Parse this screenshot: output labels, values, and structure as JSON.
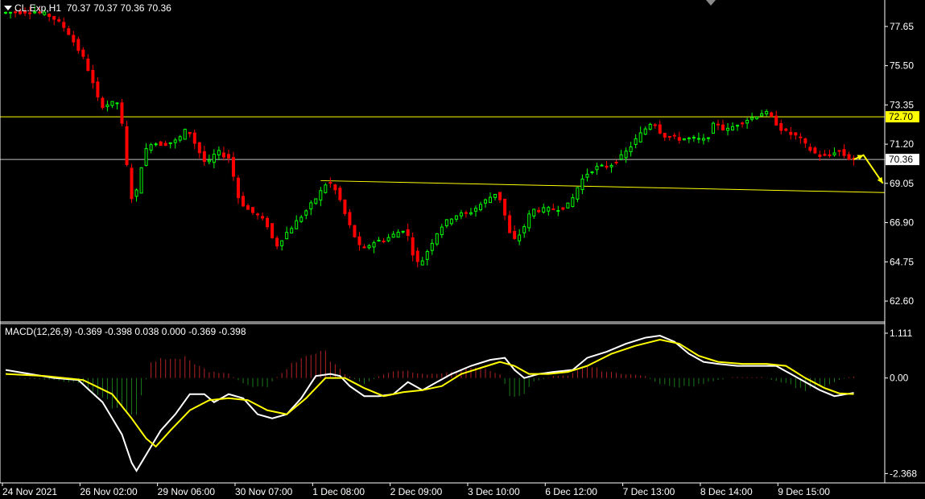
{
  "header": {
    "symbol": "CL.Exp,H1",
    "ohlc": "70.37 70.37 70.36 70.36"
  },
  "macd_header": "MACD(12,26,9) -0.369 -0.398 0.038 0.000 -0.369 -0.398",
  "colors": {
    "background": "#000000",
    "bull_candle": "#00ff00",
    "bear_candle": "#ff0000",
    "level_line": "#ffff00",
    "current_line": "#c0c0c0",
    "macd_main": "#ffffff",
    "macd_signal": "#ffff00",
    "hist_positive": "#b32222",
    "hist_negative": "#1a7a1a",
    "price_tag": "#ffff00",
    "text": "#ffffff"
  },
  "icons": [
    "menu-triangle-icon",
    "scroll-marker-icon",
    "arrow-icon"
  ],
  "chart_data": [
    {
      "type": "candlestick",
      "title": "CL.Exp,H1",
      "price_axis_labels": [
        "77.65",
        "75.50",
        "73.35",
        "71.20",
        "69.05",
        "66.90",
        "64.75",
        "62.60"
      ],
      "time_axis_labels": [
        "24 Nov 2021",
        "26 Nov 02:00",
        "29 Nov 06:00",
        "30 Nov 07:00",
        "1 Dec 08:00",
        "2 Dec 09:00",
        "3 Dec 10:00",
        "6 Dec 12:00",
        "7 Dec 13:00",
        "8 Dec 14:00",
        "9 Dec 15:00"
      ],
      "ylim": [
        61.5,
        79.1
      ],
      "horizontal_level": {
        "value": 72.7,
        "label": "72.70"
      },
      "current_price": {
        "value": 70.36,
        "label": "70.36"
      },
      "trendline": {
        "from": {
          "x": "1 Dec 08:00",
          "y": 69.2
        },
        "to": {
          "x": "9 Dec 15:00",
          "y": 68.5
        }
      },
      "price_path": [
        {
          "x": 0,
          "y": 78.4
        },
        {
          "x": 6,
          "y": 78.5
        },
        {
          "x": 10,
          "y": 78.2
        },
        {
          "x": 13,
          "y": 77.5
        },
        {
          "x": 17,
          "y": 75.7
        },
        {
          "x": 20,
          "y": 73.3
        },
        {
          "x": 24,
          "y": 73.5
        },
        {
          "x": 25,
          "y": 71.0
        },
        {
          "x": 26,
          "y": 69.0
        },
        {
          "x": 27,
          "y": 67.6
        },
        {
          "x": 28,
          "y": 69.6
        },
        {
          "x": 30,
          "y": 71.3
        },
        {
          "x": 33,
          "y": 71.2
        },
        {
          "x": 36,
          "y": 71.4
        },
        {
          "x": 38,
          "y": 72.1
        },
        {
          "x": 40,
          "y": 71.0
        },
        {
          "x": 42,
          "y": 70.0
        },
        {
          "x": 44,
          "y": 70.8
        },
        {
          "x": 47,
          "y": 70.4
        },
        {
          "x": 48,
          "y": 68.5
        },
        {
          "x": 50,
          "y": 67.7
        },
        {
          "x": 53,
          "y": 67.2
        },
        {
          "x": 55,
          "y": 66.6
        },
        {
          "x": 56,
          "y": 65.5
        },
        {
          "x": 58,
          "y": 66.2
        },
        {
          "x": 61,
          "y": 67.1
        },
        {
          "x": 63,
          "y": 67.7
        },
        {
          "x": 65,
          "y": 68.4
        },
        {
          "x": 67,
          "y": 69.2
        },
        {
          "x": 69,
          "y": 68.5
        },
        {
          "x": 71,
          "y": 67.0
        },
        {
          "x": 74,
          "y": 65.3
        },
        {
          "x": 76,
          "y": 65.8
        },
        {
          "x": 79,
          "y": 66.0
        },
        {
          "x": 83,
          "y": 66.6
        },
        {
          "x": 85,
          "y": 64.8
        },
        {
          "x": 86,
          "y": 64.6
        },
        {
          "x": 88,
          "y": 65.6
        },
        {
          "x": 90,
          "y": 66.6
        },
        {
          "x": 93,
          "y": 67.3
        },
        {
          "x": 96,
          "y": 67.4
        },
        {
          "x": 99,
          "y": 68.0
        },
        {
          "x": 102,
          "y": 68.6
        },
        {
          "x": 103,
          "y": 67.8
        },
        {
          "x": 105,
          "y": 65.8
        },
        {
          "x": 107,
          "y": 66.4
        },
        {
          "x": 109,
          "y": 67.6
        },
        {
          "x": 112,
          "y": 67.6
        },
        {
          "x": 115,
          "y": 67.7
        },
        {
          "x": 117,
          "y": 67.9
        },
        {
          "x": 118,
          "y": 68.6
        },
        {
          "x": 120,
          "y": 69.5
        },
        {
          "x": 122,
          "y": 69.9
        },
        {
          "x": 125,
          "y": 70.0
        },
        {
          "x": 128,
          "y": 70.6
        },
        {
          "x": 131,
          "y": 71.6
        },
        {
          "x": 134,
          "y": 72.5
        },
        {
          "x": 136,
          "y": 71.7
        },
        {
          "x": 139,
          "y": 71.5
        },
        {
          "x": 142,
          "y": 71.5
        },
        {
          "x": 145,
          "y": 71.4
        },
        {
          "x": 147,
          "y": 72.5
        },
        {
          "x": 149,
          "y": 71.9
        },
        {
          "x": 152,
          "y": 72.4
        },
        {
          "x": 155,
          "y": 72.7
        },
        {
          "x": 157,
          "y": 73.0
        },
        {
          "x": 159,
          "y": 72.5
        },
        {
          "x": 161,
          "y": 71.9
        },
        {
          "x": 164,
          "y": 71.6
        },
        {
          "x": 166,
          "y": 71.0
        },
        {
          "x": 168,
          "y": 70.6
        },
        {
          "x": 170,
          "y": 70.5
        },
        {
          "x": 172,
          "y": 70.9
        },
        {
          "x": 174,
          "y": 70.5
        },
        {
          "x": 175,
          "y": 70.36
        }
      ],
      "projection_arrow": [
        {
          "x": 175,
          "y": 70.36
        },
        {
          "x": 177,
          "y": 70.6
        },
        {
          "x": 181,
          "y": 69.05
        }
      ]
    },
    {
      "type": "line",
      "title": "MACD(12,26,9)",
      "axis_labels": [
        "1.111",
        "0.00",
        "-2.368"
      ],
      "ylim": [
        -2.6,
        1.35
      ],
      "series": [
        {
          "role": "main",
          "points": [
            {
              "x": 0,
              "y": 0.2
            },
            {
              "x": 5,
              "y": 0.1
            },
            {
              "x": 10,
              "y": 0.0
            },
            {
              "x": 15,
              "y": -0.05
            },
            {
              "x": 20,
              "y": -0.6
            },
            {
              "x": 24,
              "y": -1.4
            },
            {
              "x": 26,
              "y": -2.1
            },
            {
              "x": 27,
              "y": -2.3
            },
            {
              "x": 29,
              "y": -1.9
            },
            {
              "x": 32,
              "y": -1.3
            },
            {
              "x": 35,
              "y": -0.9
            },
            {
              "x": 38,
              "y": -0.4
            },
            {
              "x": 41,
              "y": -0.4
            },
            {
              "x": 43,
              "y": -0.6
            },
            {
              "x": 46,
              "y": -0.4
            },
            {
              "x": 49,
              "y": -0.5
            },
            {
              "x": 52,
              "y": -0.9
            },
            {
              "x": 55,
              "y": -1.0
            },
            {
              "x": 58,
              "y": -0.9
            },
            {
              "x": 61,
              "y": -0.5
            },
            {
              "x": 64,
              "y": 0.05
            },
            {
              "x": 67,
              "y": 0.1
            },
            {
              "x": 69,
              "y": 0.05
            },
            {
              "x": 71,
              "y": -0.2
            },
            {
              "x": 74,
              "y": -0.45
            },
            {
              "x": 77,
              "y": -0.45
            },
            {
              "x": 80,
              "y": -0.4
            },
            {
              "x": 83,
              "y": -0.1
            },
            {
              "x": 86,
              "y": -0.3
            },
            {
              "x": 89,
              "y": -0.1
            },
            {
              "x": 92,
              "y": 0.1
            },
            {
              "x": 96,
              "y": 0.3
            },
            {
              "x": 100,
              "y": 0.45
            },
            {
              "x": 103,
              "y": 0.5
            },
            {
              "x": 105,
              "y": 0.2
            },
            {
              "x": 107,
              "y": 0.0
            },
            {
              "x": 110,
              "y": 0.1
            },
            {
              "x": 113,
              "y": 0.15
            },
            {
              "x": 117,
              "y": 0.2
            },
            {
              "x": 120,
              "y": 0.5
            },
            {
              "x": 124,
              "y": 0.65
            },
            {
              "x": 128,
              "y": 0.85
            },
            {
              "x": 132,
              "y": 1.0
            },
            {
              "x": 135,
              "y": 1.05
            },
            {
              "x": 138,
              "y": 0.9
            },
            {
              "x": 141,
              "y": 0.6
            },
            {
              "x": 144,
              "y": 0.4
            },
            {
              "x": 147,
              "y": 0.35
            },
            {
              "x": 151,
              "y": 0.3
            },
            {
              "x": 155,
              "y": 0.3
            },
            {
              "x": 159,
              "y": 0.3
            },
            {
              "x": 162,
              "y": 0.1
            },
            {
              "x": 165,
              "y": -0.1
            },
            {
              "x": 168,
              "y": -0.3
            },
            {
              "x": 171,
              "y": -0.45
            },
            {
              "x": 175,
              "y": -0.369
            }
          ]
        },
        {
          "role": "signal",
          "points": [
            {
              "x": 0,
              "y": 0.1
            },
            {
              "x": 8,
              "y": 0.05
            },
            {
              "x": 16,
              "y": -0.05
            },
            {
              "x": 22,
              "y": -0.4
            },
            {
              "x": 26,
              "y": -1.0
            },
            {
              "x": 29,
              "y": -1.5
            },
            {
              "x": 31,
              "y": -1.7
            },
            {
              "x": 34,
              "y": -1.3
            },
            {
              "x": 38,
              "y": -0.8
            },
            {
              "x": 42,
              "y": -0.55
            },
            {
              "x": 46,
              "y": -0.5
            },
            {
              "x": 50,
              "y": -0.55
            },
            {
              "x": 54,
              "y": -0.8
            },
            {
              "x": 58,
              "y": -0.9
            },
            {
              "x": 62,
              "y": -0.5
            },
            {
              "x": 66,
              "y": 0.0
            },
            {
              "x": 70,
              "y": 0.0
            },
            {
              "x": 74,
              "y": -0.25
            },
            {
              "x": 78,
              "y": -0.45
            },
            {
              "x": 82,
              "y": -0.35
            },
            {
              "x": 86,
              "y": -0.3
            },
            {
              "x": 90,
              "y": -0.2
            },
            {
              "x": 94,
              "y": 0.1
            },
            {
              "x": 98,
              "y": 0.25
            },
            {
              "x": 102,
              "y": 0.4
            },
            {
              "x": 105,
              "y": 0.3
            },
            {
              "x": 108,
              "y": 0.1
            },
            {
              "x": 112,
              "y": 0.1
            },
            {
              "x": 116,
              "y": 0.15
            },
            {
              "x": 120,
              "y": 0.3
            },
            {
              "x": 125,
              "y": 0.6
            },
            {
              "x": 130,
              "y": 0.8
            },
            {
              "x": 135,
              "y": 0.95
            },
            {
              "x": 139,
              "y": 0.85
            },
            {
              "x": 143,
              "y": 0.55
            },
            {
              "x": 147,
              "y": 0.4
            },
            {
              "x": 152,
              "y": 0.35
            },
            {
              "x": 157,
              "y": 0.35
            },
            {
              "x": 161,
              "y": 0.3
            },
            {
              "x": 165,
              "y": 0.0
            },
            {
              "x": 169,
              "y": -0.25
            },
            {
              "x": 172,
              "y": -0.38
            },
            {
              "x": 175,
              "y": -0.398
            }
          ]
        }
      ],
      "histogram_profile": [
        {
          "x": 0,
          "y": 0.0
        },
        {
          "x": 10,
          "y": -0.05
        },
        {
          "x": 16,
          "y": -0.15
        },
        {
          "x": 22,
          "y": -0.7
        },
        {
          "x": 27,
          "y": -0.9
        },
        {
          "x": 30,
          "y": 0.4
        },
        {
          "x": 34,
          "y": 0.55
        },
        {
          "x": 38,
          "y": 0.45
        },
        {
          "x": 42,
          "y": 0.15
        },
        {
          "x": 46,
          "y": 0.1
        },
        {
          "x": 50,
          "y": -0.2
        },
        {
          "x": 54,
          "y": -0.2
        },
        {
          "x": 58,
          "y": 0.25
        },
        {
          "x": 62,
          "y": 0.6
        },
        {
          "x": 66,
          "y": 0.6
        },
        {
          "x": 70,
          "y": 0.1
        },
        {
          "x": 74,
          "y": -0.15
        },
        {
          "x": 78,
          "y": 0.1
        },
        {
          "x": 82,
          "y": 0.2
        },
        {
          "x": 86,
          "y": 0.1
        },
        {
          "x": 90,
          "y": 0.1
        },
        {
          "x": 94,
          "y": 0.2
        },
        {
          "x": 98,
          "y": 0.25
        },
        {
          "x": 102,
          "y": 0.1
        },
        {
          "x": 104,
          "y": -0.4
        },
        {
          "x": 106,
          "y": -0.5
        },
        {
          "x": 109,
          "y": -0.1
        },
        {
          "x": 113,
          "y": 0.05
        },
        {
          "x": 116,
          "y": 0.05
        },
        {
          "x": 120,
          "y": 0.3
        },
        {
          "x": 124,
          "y": 0.15
        },
        {
          "x": 128,
          "y": 0.1
        },
        {
          "x": 132,
          "y": 0.05
        },
        {
          "x": 134,
          "y": -0.1
        },
        {
          "x": 138,
          "y": -0.25
        },
        {
          "x": 142,
          "y": -0.2
        },
        {
          "x": 145,
          "y": -0.1
        },
        {
          "x": 150,
          "y": 0.02
        },
        {
          "x": 156,
          "y": 0.02
        },
        {
          "x": 160,
          "y": -0.1
        },
        {
          "x": 165,
          "y": -0.3
        },
        {
          "x": 169,
          "y": -0.2
        },
        {
          "x": 172,
          "y": -0.05
        },
        {
          "x": 174,
          "y": 0.02
        },
        {
          "x": 175,
          "y": 0.038
        }
      ]
    }
  ]
}
